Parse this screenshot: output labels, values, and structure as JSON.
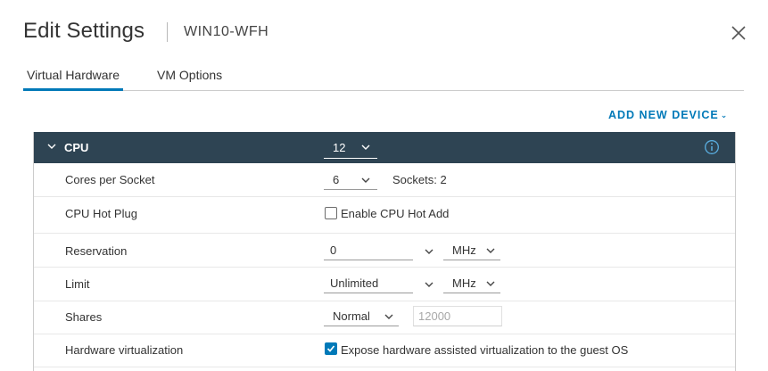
{
  "header": {
    "title": "Edit Settings",
    "vm_name": "WIN10-WFH"
  },
  "tabs": [
    {
      "label": "Virtual Hardware",
      "active": true
    },
    {
      "label": "VM Options",
      "active": false
    }
  ],
  "toolbar": {
    "add_device_label": "ADD NEW DEVICE"
  },
  "cpu": {
    "label": "CPU",
    "value": "12",
    "rows": {
      "cores_per_socket": {
        "label": "Cores per Socket",
        "value": "6",
        "sockets_text": "Sockets: 2"
      },
      "hot_plug": {
        "label": "CPU Hot Plug",
        "checkbox_label": "Enable CPU Hot Add",
        "checked": false
      },
      "reservation": {
        "label": "Reservation",
        "value": "0",
        "unit": "MHz"
      },
      "limit": {
        "label": "Limit",
        "value": "Unlimited",
        "unit": "MHz"
      },
      "shares": {
        "label": "Shares",
        "value": "Normal",
        "amount": "12000"
      },
      "hw_virtualization": {
        "label": "Hardware virtualization",
        "checkbox_label": "Expose hardware assisted virtualization to the guest OS",
        "checked": true
      }
    }
  },
  "colors": {
    "accent": "#0079b8",
    "header_bg": "#2e4453"
  },
  "icons": {
    "close": "close-icon",
    "collapse": "chevron-down-icon",
    "info": "info-icon",
    "dropdown": "chevron-down-icon"
  }
}
